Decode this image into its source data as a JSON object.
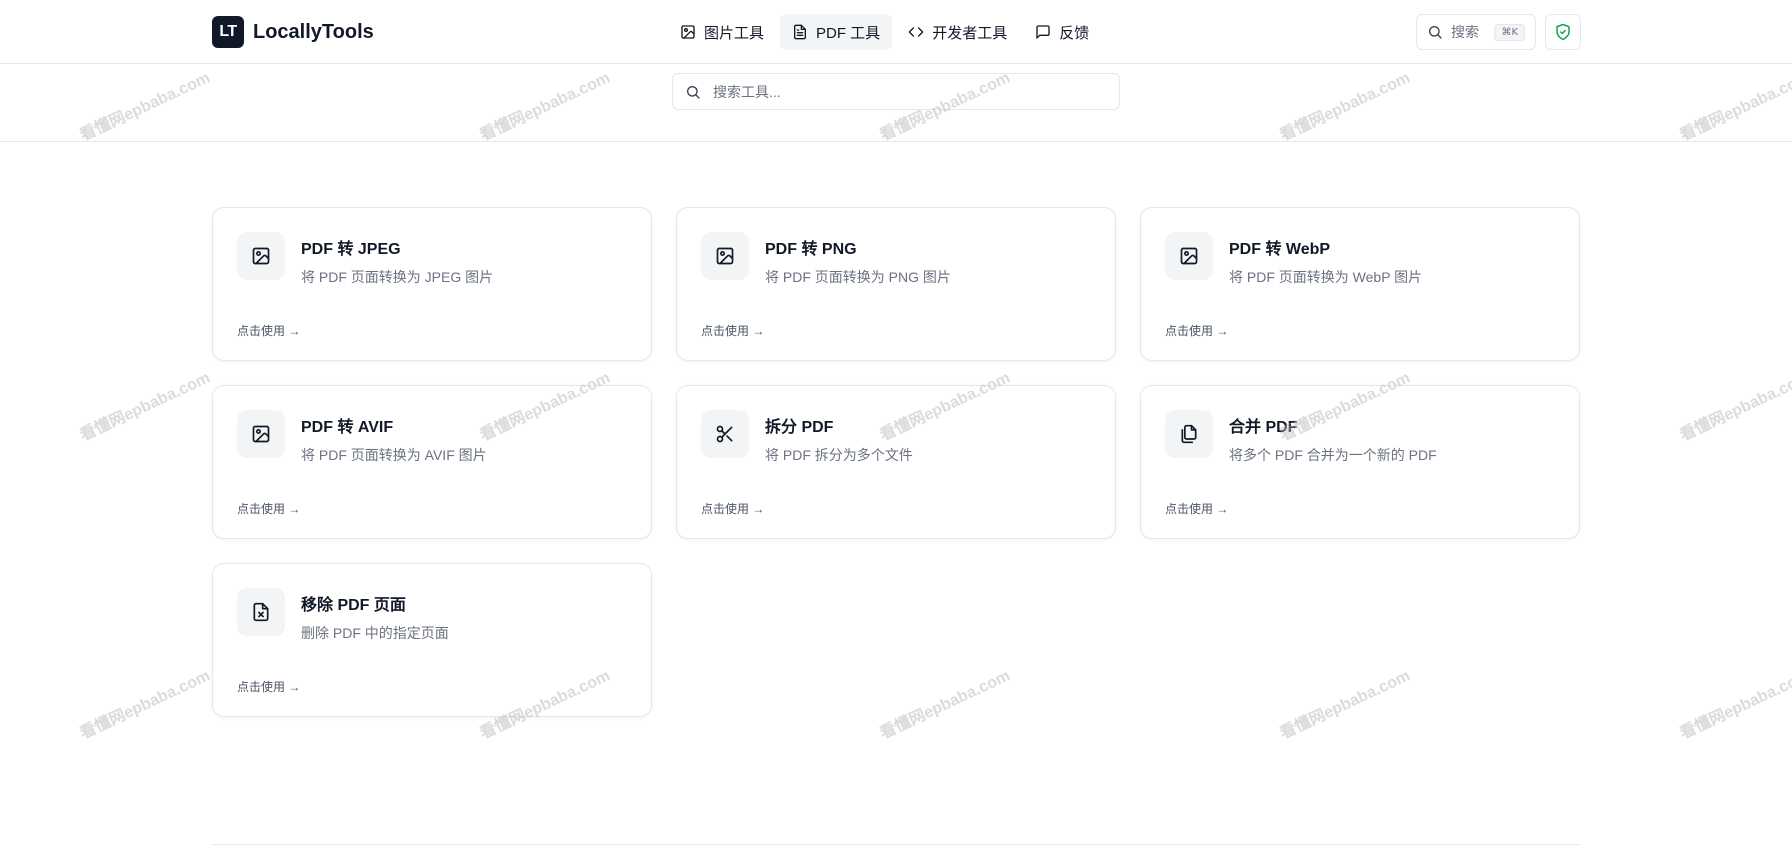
{
  "header": {
    "logo_mark": "LT",
    "logo_text": "LocallyTools",
    "nav": [
      {
        "label": "图片工具",
        "icon": "image-icon"
      },
      {
        "label": "PDF 工具",
        "icon": "file-text-icon",
        "active": true
      },
      {
        "label": "开发者工具",
        "icon": "code-icon"
      },
      {
        "label": "反馈",
        "icon": "message-square-icon"
      }
    ],
    "search_label": "搜索",
    "search_shortcut": "⌘K",
    "shield_icon": "shield-check-icon"
  },
  "tool_search": {
    "placeholder": "搜索工具..."
  },
  "colors": {
    "accent": "#111827",
    "muted": "#6b7280",
    "border": "#e5e7eb",
    "icon_bg": "#f3f4f6",
    "shield": "#16a34a"
  },
  "cards": [
    {
      "title": "PDF 转 JPEG",
      "desc": "将 PDF 页面转换为 JPEG 图片",
      "link": "点击使用 →",
      "icon": "image-icon"
    },
    {
      "title": "PDF 转 PNG",
      "desc": "将 PDF 页面转换为 PNG 图片",
      "link": "点击使用 →",
      "icon": "image-icon"
    },
    {
      "title": "PDF 转 WebP",
      "desc": "将 PDF 页面转换为 WebP 图片",
      "link": "点击使用 →",
      "icon": "image-icon"
    },
    {
      "title": "PDF 转 AVIF",
      "desc": "将 PDF 页面转换为 AVIF 图片",
      "link": "点击使用 →",
      "icon": "image-icon"
    },
    {
      "title": "拆分 PDF",
      "desc": "将 PDF 拆分为多个文件",
      "link": "点击使用 →",
      "icon": "scissors-icon"
    },
    {
      "title": "合并 PDF",
      "desc": "将多个 PDF 合并为一个新的 PDF",
      "link": "点击使用 →",
      "icon": "files-icon"
    },
    {
      "title": "移除 PDF 页面",
      "desc": "删除 PDF 中的指定页面",
      "link": "点击使用 →",
      "icon": "file-x-icon"
    }
  ],
  "watermark": {
    "cn": "看懂网",
    "en": "epbaba.com"
  }
}
